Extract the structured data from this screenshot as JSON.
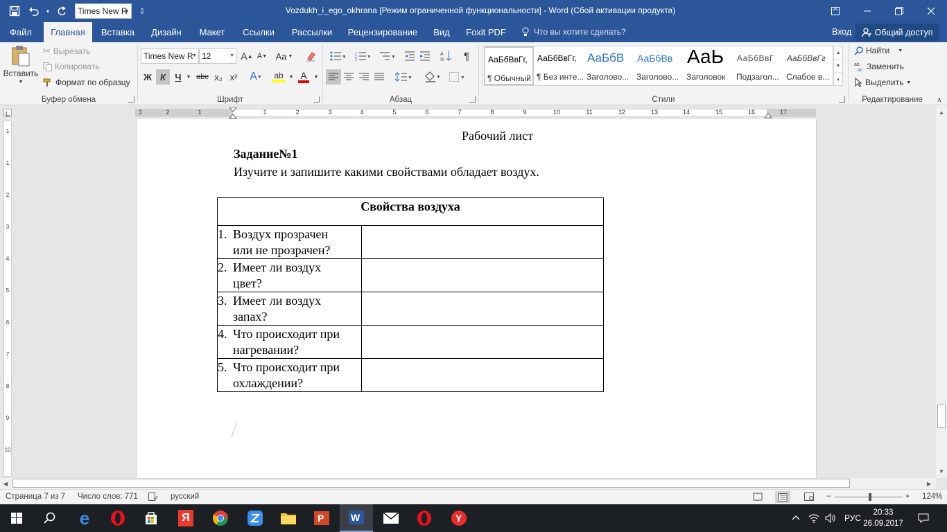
{
  "window": {
    "title": "Vozdukh_i_ego_okhrana [Режим ограниченной функциональности] - Word (Сбой активации продукта)",
    "qat_font": "Times New R"
  },
  "tabs": [
    "Файл",
    "Главная",
    "Вставка",
    "Дизайн",
    "Макет",
    "Ссылки",
    "Рассылки",
    "Рецензирование",
    "Вид",
    "Foxit PDF"
  ],
  "tell_me": "Что вы хотите сделать?",
  "login": "Вход",
  "share": "Общий доступ",
  "ribbon": {
    "clipboard": {
      "paste": "Вставить",
      "cut": "Вырезать",
      "copy": "Копировать",
      "format_painter": "Формат по образцу",
      "label": "Буфер обмена"
    },
    "font": {
      "family": "Times New R",
      "size": "12",
      "label": "Шрифт",
      "bold": "Ж",
      "italic": "К",
      "underline": "Ч",
      "strike": "abc",
      "subscript": "x₂",
      "superscript": "x²",
      "change_case": "Aa",
      "grow": "A",
      "shrink": "A",
      "text_effects": "A",
      "font_color": "A"
    },
    "paragraph": {
      "label": "Абзац"
    },
    "styles": {
      "label": "Стили",
      "items": [
        {
          "sample": "АаБбВвГг,",
          "name": "¶ Обычный"
        },
        {
          "sample": "АаБбВвГг,",
          "name": "¶ Без инте..."
        },
        {
          "sample": "АаБбВ",
          "name": "Заголово..."
        },
        {
          "sample": "АаБбВв",
          "name": "Заголово..."
        },
        {
          "sample": "АаЬ",
          "name": "Заголовок"
        },
        {
          "sample": "АаБбВвГ",
          "name": "Подзагол..."
        },
        {
          "sample": "АаБбВвГг",
          "name": "Слабое в..."
        }
      ]
    },
    "editing": {
      "label": "Редактирование",
      "find": "Найти",
      "replace": "Заменить",
      "select": "Выделить"
    }
  },
  "ruler": {
    "numbers": [
      "3",
      "2",
      "1",
      "1",
      "2",
      "3",
      "4",
      "5",
      "6",
      "7",
      "8",
      "9",
      "10",
      "11",
      "12",
      "13",
      "14",
      "15",
      "16",
      "17"
    ],
    "vnumbers": [
      "1",
      "1",
      "2",
      "3",
      "4",
      "5",
      "6",
      "7",
      "8",
      "9",
      "10"
    ]
  },
  "document": {
    "heading": "Рабочий лист",
    "task_title": "Задание№1",
    "task_text": "Изучите и запишите какими свойствами обладает воздух.",
    "table_header": "Свойства воздуха",
    "rows": [
      {
        "num": "1.",
        "line1": "Воздух прозрачен",
        "line2": "или не прозрачен?"
      },
      {
        "num": "2.",
        "line1": "Имеет ли воздух",
        "line2": "цвет?"
      },
      {
        "num": "3.",
        "line1": "Имеет ли воздух",
        "line2": "запах?"
      },
      {
        "num": "4.",
        "line1": "Что происходит при",
        "line2": "нагревании?"
      },
      {
        "num": "5.",
        "line1": "Что происходит при",
        "line2": "охлаждении?"
      }
    ]
  },
  "status": {
    "page": "Страница 7 из 7",
    "words": "Число слов: 771",
    "language": "русский",
    "zoom": "124%",
    "zoom_minus": "−",
    "zoom_plus": "+"
  },
  "taskbar": {
    "lang": "РУС",
    "time": "20:33",
    "date": "26.09.2017"
  },
  "colors": {
    "word_blue": "#2b579a",
    "ribbon_bg": "#f3f3f3",
    "taskbar": "#1c1f24"
  }
}
